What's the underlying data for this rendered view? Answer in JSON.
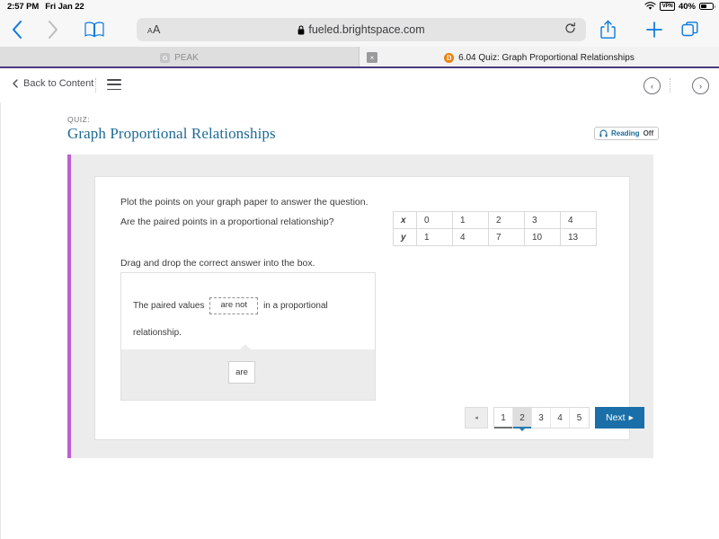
{
  "status_bar": {
    "time": "2:57 PM",
    "date": "Fri Jan 22",
    "vpn": "VPN",
    "battery_pct": "40%"
  },
  "browser": {
    "url": "fueled.brightspace.com",
    "text_size_small": "A",
    "text_size_large": "A",
    "tabs": [
      {
        "title": "PEAK",
        "favicon_letter": "G",
        "active": false
      },
      {
        "title": "6.04 Quiz: Graph Proportional Relationships",
        "favicon_letter": "D",
        "active": true
      }
    ],
    "close_label": "×"
  },
  "content_nav": {
    "back_label": "Back to Content",
    "title": "6.04 Quiz: Graph Proportional Relationships",
    "prev_label": "‹",
    "next_label": "›"
  },
  "quiz": {
    "eyebrow": "QUIZ:",
    "title": "Graph Proportional Relationships",
    "reading_label": "Reading",
    "reading_state": "Off"
  },
  "question": {
    "instruction_1": "Plot the points on your graph paper to answer the question.",
    "instruction_2": "Are the paired points in a proportional relationship?",
    "instruction_3": "Drag and drop the correct answer into the box.",
    "sentence_before": "The paired values",
    "sentence_after": "in a proportional relationship.",
    "dropped_answer": "are not",
    "drag_tile": "are"
  },
  "table": {
    "rows": [
      {
        "label": "x",
        "values": [
          "0",
          "1",
          "2",
          "3",
          "4"
        ]
      },
      {
        "label": "y",
        "values": [
          "1",
          "4",
          "7",
          "10",
          "13"
        ]
      }
    ]
  },
  "pagination": {
    "prev": "◂",
    "pages": [
      "1",
      "2",
      "3",
      "4",
      "5"
    ],
    "active_index": 1,
    "next_label": "Next",
    "next_arrow": "▸"
  },
  "colors": {
    "accent_purple": "#bc5fd3",
    "title_blue": "#1d6a96",
    "next_blue": "#1b6fa8",
    "tab_underline": "#4b3a7d",
    "favicon_orange": "#e8820c"
  }
}
